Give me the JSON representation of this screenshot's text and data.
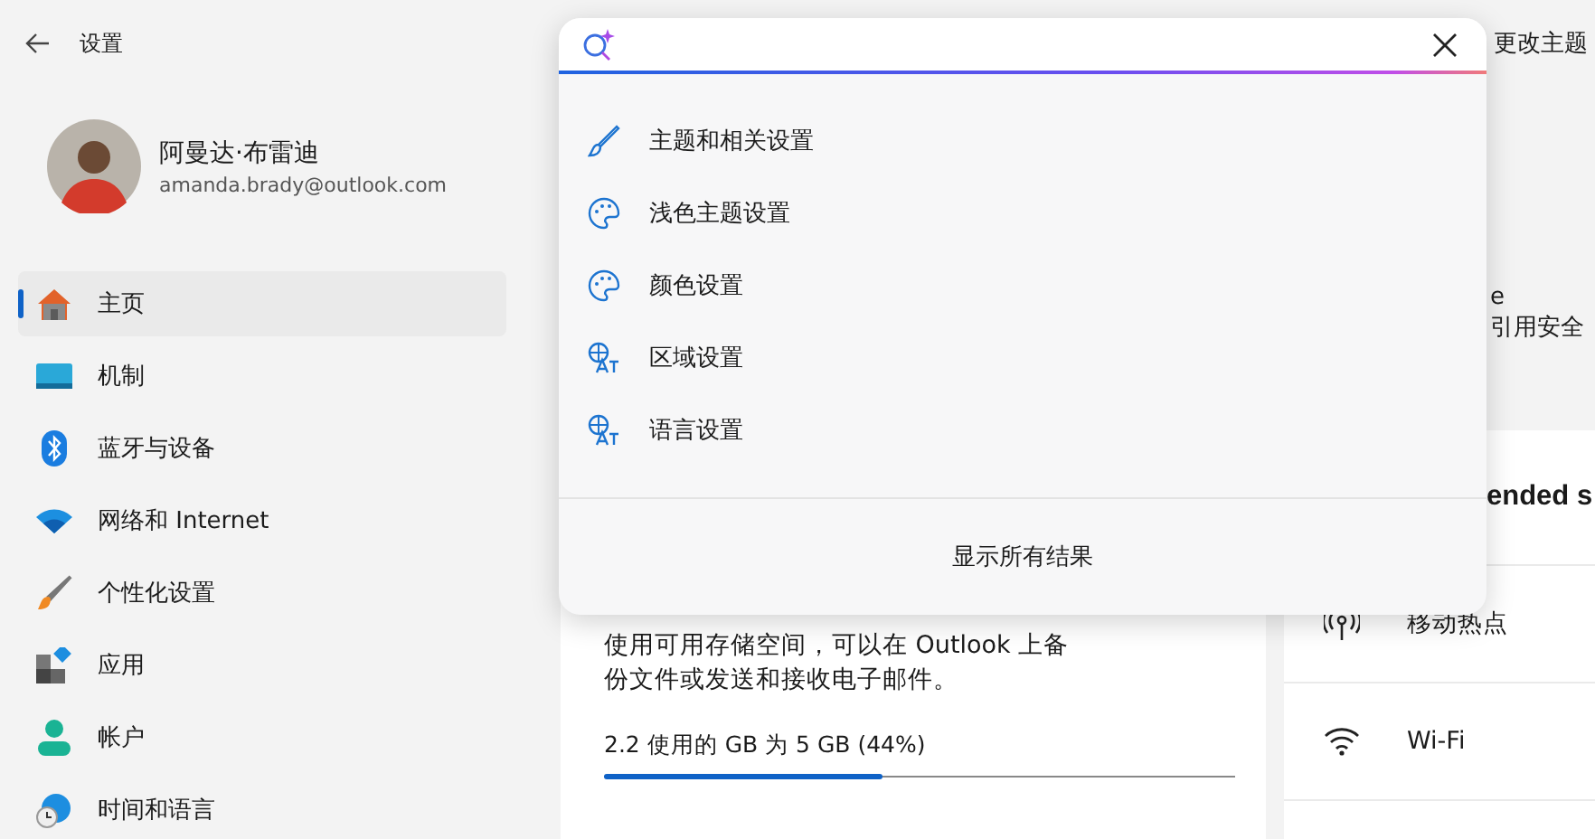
{
  "window": {
    "title": "设置"
  },
  "user": {
    "name": "阿曼达·布雷迪",
    "email": "amanda.brady@outlook.com"
  },
  "sidebar": {
    "items": [
      {
        "label": "主页",
        "selected": true
      },
      {
        "label": "机制",
        "selected": false
      },
      {
        "label": "蓝牙与设备",
        "selected": false
      },
      {
        "label": "网络和 Internet",
        "selected": false
      },
      {
        "label": "个性化设置",
        "selected": false
      },
      {
        "label": "应用",
        "selected": false
      },
      {
        "label": "帐户",
        "selected": false
      },
      {
        "label": "时间和语言",
        "selected": false
      }
    ]
  },
  "search": {
    "results": [
      "主题和相关设置",
      "浅色主题设置",
      "颜色设置",
      "区域设置",
      "语言设置"
    ],
    "show_all": "显示所有结果"
  },
  "background": {
    "header_text": "更改主题",
    "card_text_1": "e",
    "card_text_2": "引用安全",
    "recommended_title": "ended s",
    "recommended_items": [
      "移动热点",
      "Wi-Fi"
    ],
    "storage": {
      "description": "使用可用存储空间，可以在 Outlook 上备份文件或发送和接收电子邮件。",
      "usage": "2.2 使用的 GB 为 5 GB (44%)",
      "level": 0.44
    }
  }
}
